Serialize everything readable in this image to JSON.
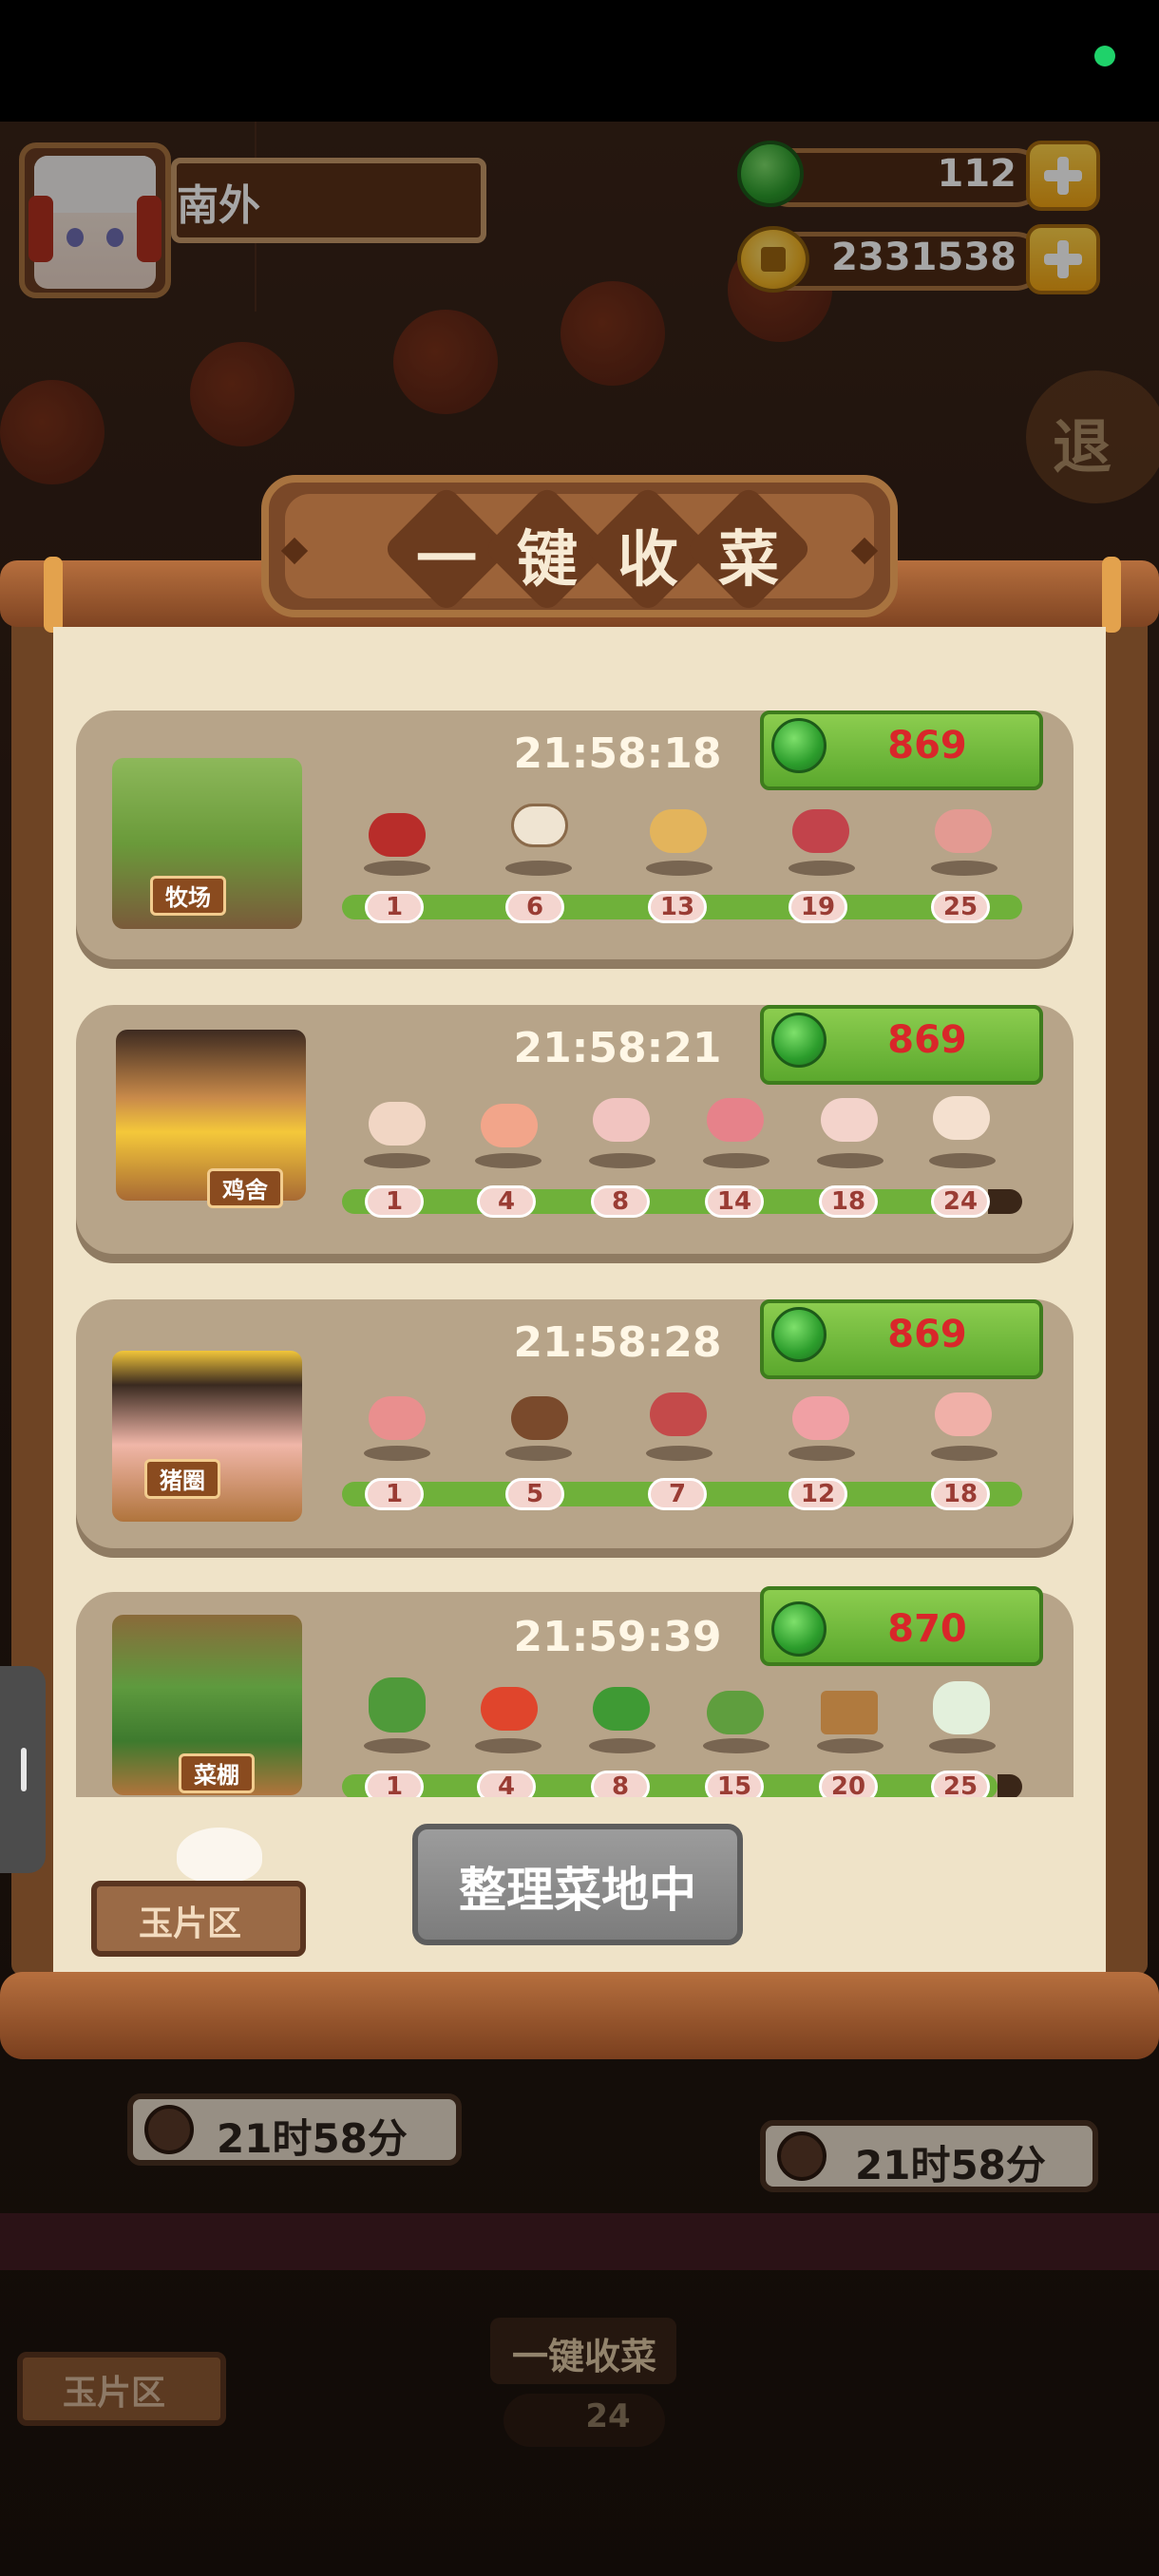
{
  "header": {
    "player_name": "南外",
    "jade_count": "112",
    "coin_count": "2331538"
  },
  "panel": {
    "title_chars": [
      "一",
      "键",
      "收",
      "菜"
    ],
    "rows": [
      {
        "building": "牧场",
        "timer": "21:58:18",
        "reward": "869",
        "milestones": [
          "1",
          "6",
          "13",
          "19",
          "25"
        ],
        "items": [
          "meat-icon",
          "jar-icon",
          "bread-icon",
          "steak-icon",
          "ham-icon"
        ]
      },
      {
        "building": "鸡舍",
        "timer": "21:58:21",
        "reward": "869",
        "milestones": [
          "1",
          "4",
          "8",
          "14",
          "18",
          "24"
        ],
        "items": [
          "egg-icon",
          "chicken-breast-icon",
          "whole-chicken-icon",
          "chicken-dish-icon",
          "drumstick-icon",
          "roast-chicken-icon"
        ]
      },
      {
        "building": "猪圈",
        "timer": "21:58:28",
        "reward": "869",
        "milestones": [
          "1",
          "5",
          "7",
          "12",
          "18"
        ],
        "items": [
          "bacon-icon",
          "pudding-icon",
          "pork-dish-icon",
          "pork-slice-icon",
          "ham-hock-icon"
        ]
      },
      {
        "building": "菜棚",
        "timer": "21:59:39",
        "reward": "870",
        "milestones": [
          "1",
          "4",
          "8",
          "15",
          "20",
          "25"
        ],
        "items": [
          "bok-choy-icon",
          "tomato-icon",
          "pepper-icon",
          "cucumber-icon",
          "vegetable-box-icon",
          "cabbage-icon"
        ]
      }
    ],
    "organize_button": "整理菜地中",
    "jade_area_button": "玉片区"
  },
  "background": {
    "timer_left": "21时58分",
    "timer_right": "21时58分",
    "harvest_label": "一键收菜",
    "harvest_count": "24",
    "jade_area_label": "玉片区",
    "exit_label": "退"
  },
  "colors": {
    "accent_green": "#6fb13a",
    "reward_red": "#d9262a",
    "paper": "#efe3c8",
    "wood": "#7a4828"
  }
}
